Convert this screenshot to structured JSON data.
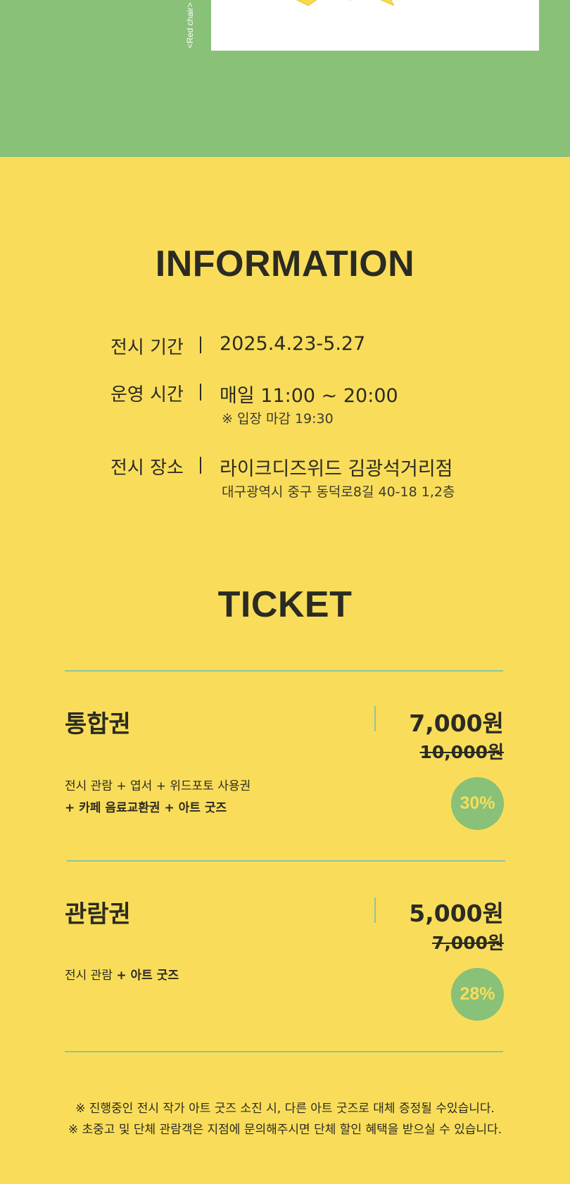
{
  "artwork": {
    "caption": "<Red chair>"
  },
  "information": {
    "title": "INFORMATION",
    "rows": [
      {
        "label": "전시 기간",
        "value": "2025.4.23-5.27",
        "sub": ""
      },
      {
        "label": "운영 시간",
        "value": "매일 11:00 ~ 20:00",
        "sub": "※ 입장 마감 19:30"
      },
      {
        "label": "전시 장소",
        "value": "라이크디즈위드 김광석거리점",
        "sub": "대구광역시 중구 동덕로8길 40-18 1,2층"
      }
    ]
  },
  "ticket": {
    "title": "TICKET",
    "items": [
      {
        "name": "통합권",
        "price": "7,000원",
        "original_price": "10,000원",
        "desc_line1": "전시 관람 + 엽서 + 위드포토 사용권",
        "desc_line2": "+ 카페 음료교환권 + 아트 굿즈",
        "discount": "30%"
      },
      {
        "name": "관람권",
        "price": "5,000원",
        "original_price": "7,000원",
        "desc_plain": "전시 관람 ",
        "desc_bold": "+ 아트 굿즈",
        "discount": "28%"
      }
    ]
  },
  "notes": [
    "※ 진행중인 전시 작가 아트 굿즈 소진 시, 다른 아트 굿즈로 대체 증정될 수있습니다.",
    "※ 초중고 및 단체 관람객은 지점에 문의해주시면 단체 할인 혜택을 받으실 수 있습니다."
  ],
  "colors": {
    "green": "#88c177",
    "yellow": "#f9dd5a",
    "text": "#2b2b22",
    "rule": "#8fc59a"
  }
}
